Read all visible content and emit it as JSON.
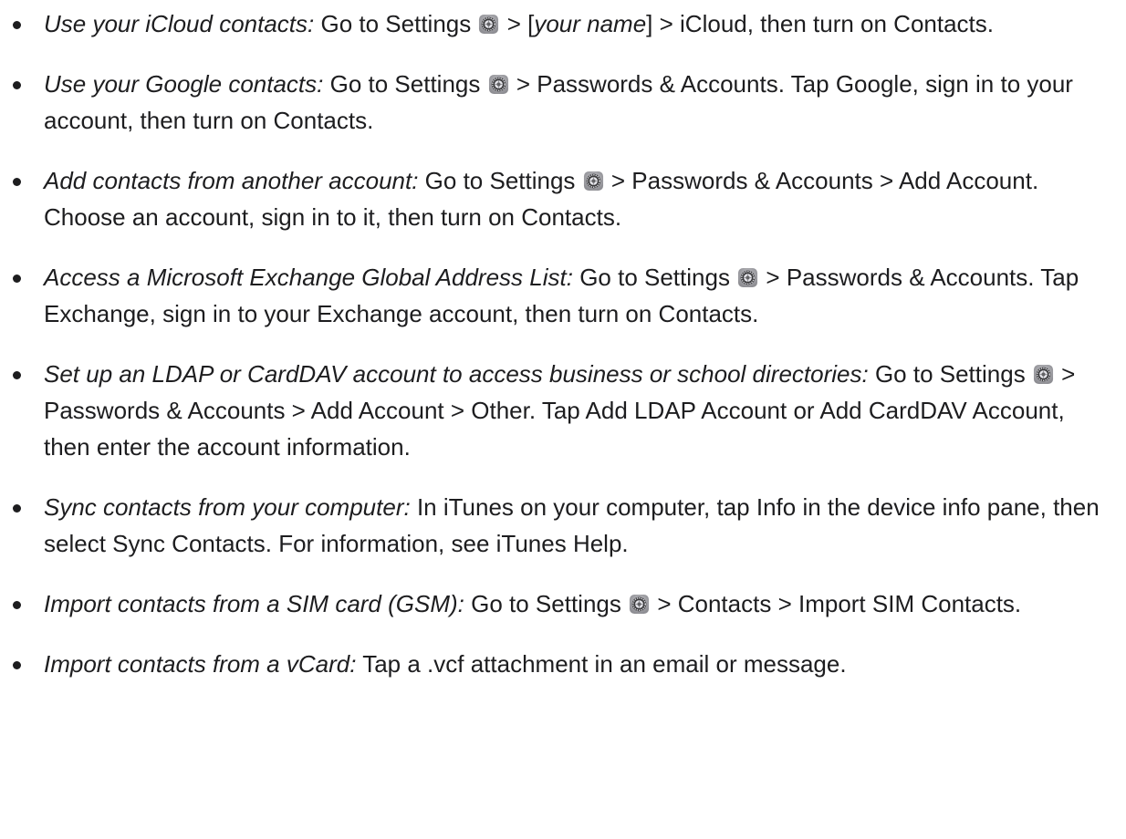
{
  "items": [
    {
      "lead": "Use your iCloud contacts:",
      "parts": [
        {
          "t": "text",
          "v": " Go to Settings "
        },
        {
          "t": "icon",
          "v": "settings-icon"
        },
        {
          "t": "text",
          "v": " > ["
        },
        {
          "t": "italic",
          "v": "your name"
        },
        {
          "t": "text",
          "v": "] > iCloud, then turn on Contacts."
        }
      ]
    },
    {
      "lead": "Use your Google contacts:",
      "parts": [
        {
          "t": "text",
          "v": " Go to Settings "
        },
        {
          "t": "icon",
          "v": "settings-icon"
        },
        {
          "t": "text",
          "v": " > Passwords & Accounts. Tap Google, sign in to your account, then turn on Contacts."
        }
      ]
    },
    {
      "lead": "Add contacts from another account:",
      "parts": [
        {
          "t": "text",
          "v": " Go to Settings "
        },
        {
          "t": "icon",
          "v": "settings-icon"
        },
        {
          "t": "text",
          "v": " > Passwords & Accounts > Add Account. Choose an account, sign in to it, then turn on Contacts."
        }
      ]
    },
    {
      "lead": "Access a Microsoft Exchange Global Address List:",
      "parts": [
        {
          "t": "text",
          "v": " Go to Settings "
        },
        {
          "t": "icon",
          "v": "settings-icon"
        },
        {
          "t": "text",
          "v": " > Passwords & Accounts. Tap Exchange, sign in to your Exchange account, then turn on Contacts."
        }
      ]
    },
    {
      "lead": "Set up an LDAP or CardDAV account to access business or school directories:",
      "parts": [
        {
          "t": "text",
          "v": " Go to Settings "
        },
        {
          "t": "icon",
          "v": "settings-icon"
        },
        {
          "t": "text",
          "v": " > Passwords & Accounts > Add Account > Other. Tap Add LDAP Account or Add CardDAV Account, then enter the account information."
        }
      ]
    },
    {
      "lead": "Sync contacts from your computer:",
      "parts": [
        {
          "t": "text",
          "v": " In iTunes on your computer, tap Info in the device info pane, then select Sync Contacts. For information, see iTunes Help."
        }
      ]
    },
    {
      "lead": "Import contacts from a SIM card (GSM):",
      "parts": [
        {
          "t": "text",
          "v": " Go to Settings "
        },
        {
          "t": "icon",
          "v": "settings-icon"
        },
        {
          "t": "text",
          "v": " > Contacts > Import SIM Contacts."
        }
      ]
    },
    {
      "lead": "Import contacts from a vCard:",
      "parts": [
        {
          "t": "text",
          "v": " Tap a .vcf attachment in an email or message."
        }
      ]
    }
  ]
}
